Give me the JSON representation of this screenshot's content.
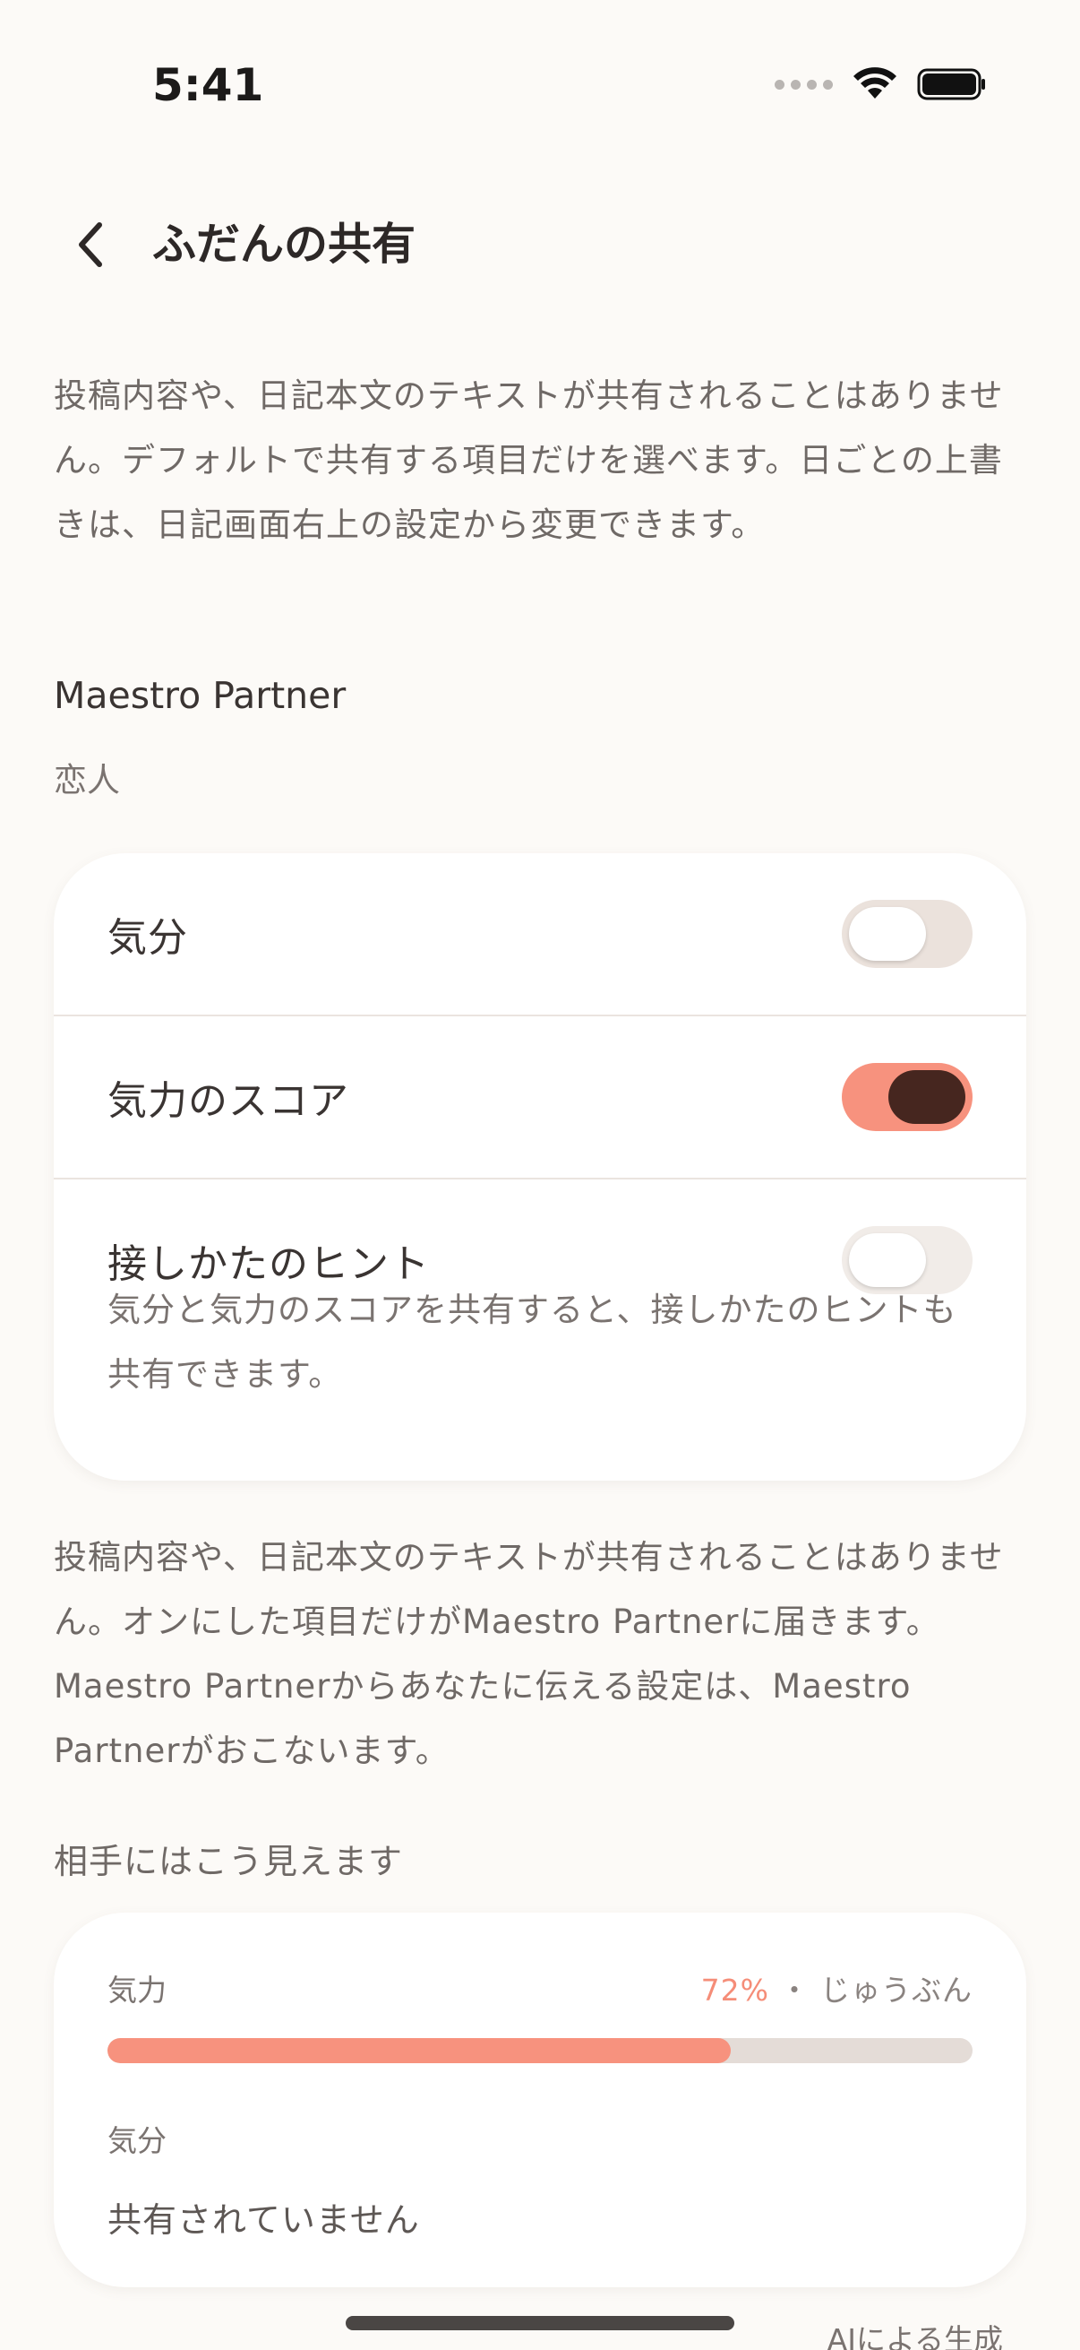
{
  "status_bar": {
    "time": "5:41"
  },
  "header": {
    "title": "ふだんの共有"
  },
  "intro_text": "投稿内容や、日記本文のテキストが共有されることはありません。デフォルトで共有する項目だけを選べます。日ごとの上書きは、日記画面右上の設定から変更できます。",
  "partner": {
    "name": "Maestro Partner",
    "relation": "恋人"
  },
  "settings": [
    {
      "label": "気分",
      "enabled": false
    },
    {
      "label": "気力のスコア",
      "enabled": true
    },
    {
      "label": "接しかたのヒント",
      "enabled": false,
      "hint": "気分と気力のスコアを共有すると、接しかたのヒントも共有できます。"
    }
  ],
  "info_text": "投稿内容や、日記本文のテキストが共有されることはありません。オンにした項目だけがMaestro Partnerに届きます。Maestro Partnerからあなたに伝える設定は、Maestro Partnerがおこないます。",
  "preview": {
    "label": "相手にはこう見えます",
    "energy_label": "気力",
    "energy_percent": "72%",
    "energy_separator": "・",
    "energy_status": "じゅうぶん",
    "energy_fraction": 0.72,
    "mood_label": "気分",
    "mood_value": "共有されていません"
  },
  "footer": {
    "ai_label": "AIによる生成"
  },
  "colors": {
    "accent": "#f7927e",
    "toggle_knob_on": "#46261f",
    "background": "#fcfaf7"
  }
}
